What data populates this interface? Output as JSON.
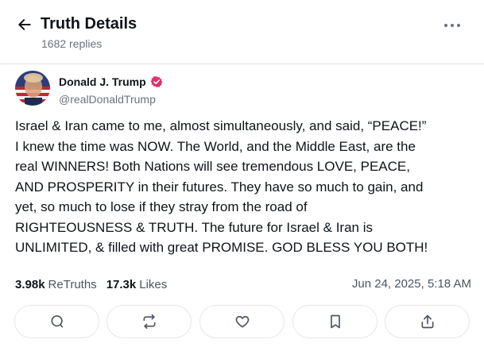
{
  "header": {
    "title": "Truth Details",
    "subtitle": "1682 replies",
    "back_icon": "arrow-left-icon",
    "more_icon": "more-horizontal-icon"
  },
  "post": {
    "author": {
      "name": "Donald J. Trump",
      "handle": "@realDonaldTrump",
      "verified_icon": "verified-badge-icon",
      "verified_color": "#e3306c"
    },
    "body_lines": [
      "Israel & Iran came to me, almost simultaneously, and said, “PEACE!”",
      "I knew the time was NOW. The World, and the Middle East, are the",
      "real WINNERS! Both Nations will see tremendous LOVE, PEACE,",
      "AND PROSPERITY in their futures. They have so much to gain, and",
      "yet, so much to lose if they stray from the road of",
      "RIGHTEOUSNESS & TRUTH. The future for Israel & Iran is",
      "UNLIMITED, & filled with great PROMISE. GOD BLESS YOU BOTH!"
    ],
    "stats": {
      "retruths_count": "3.98k",
      "retruths_label": "ReTruths",
      "likes_count": "17.3k",
      "likes_label": "Likes"
    },
    "timestamp": "Jun 24, 2025, 5:18 AM"
  },
  "actions": [
    {
      "icon": "reply-icon"
    },
    {
      "icon": "retruth-icon"
    },
    {
      "icon": "like-heart-icon"
    },
    {
      "icon": "bookmark-icon"
    },
    {
      "icon": "share-icon"
    }
  ]
}
